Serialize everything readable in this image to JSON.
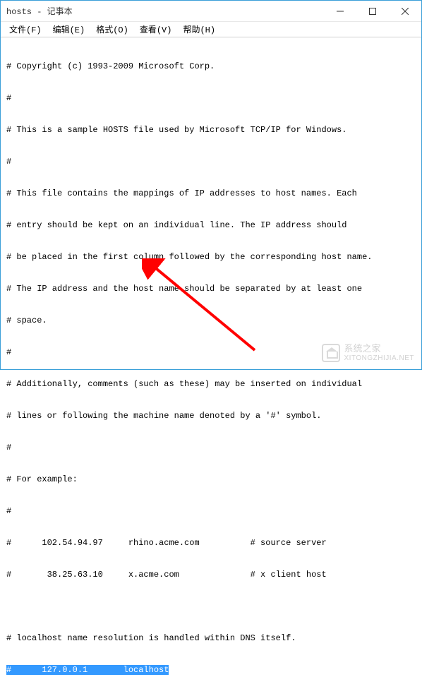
{
  "titlebar": {
    "title": "hosts - 记事本"
  },
  "menubar": {
    "file": "文件(F)",
    "edit": "编辑(E)",
    "format": "格式(O)",
    "view": "查看(V)",
    "help": "帮助(H)"
  },
  "content": {
    "lines": [
      "# Copyright (c) 1993-2009 Microsoft Corp.",
      "#",
      "# This is a sample HOSTS file used by Microsoft TCP/IP for Windows.",
      "#",
      "# This file contains the mappings of IP addresses to host names. Each",
      "# entry should be kept on an individual line. The IP address should",
      "# be placed in the first column followed by the corresponding host name.",
      "# The IP address and the host name should be separated by at least one",
      "# space.",
      "#",
      "# Additionally, comments (such as these) may be inserted on individual",
      "# lines or following the machine name denoted by a '#' symbol.",
      "#",
      "# For example:",
      "#",
      "#      102.54.94.97     rhino.acme.com          # source server",
      "#       38.25.63.10     x.acme.com              # x client host",
      "",
      "# localhost name resolution is handled within DNS itself."
    ],
    "selected_line": "#      127.0.0.1       localhost"
  },
  "watermark": {
    "cn": "系统之家",
    "url": "XITONGZHIJIA.NET"
  }
}
